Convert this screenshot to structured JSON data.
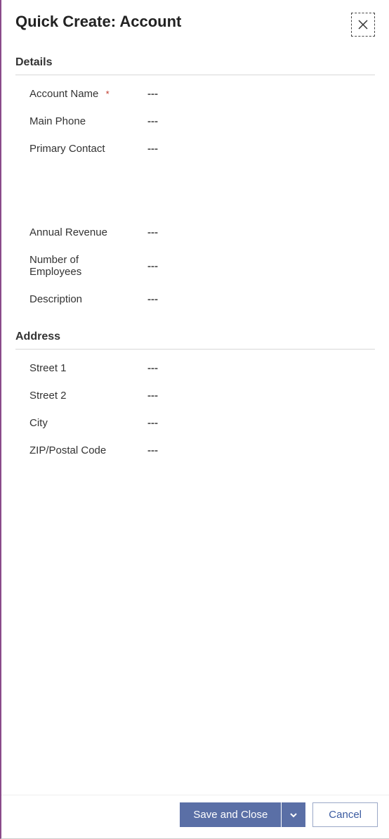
{
  "header": {
    "title": "Quick Create: Account"
  },
  "sections": {
    "details": {
      "title": "Details",
      "fields": {
        "account_name": {
          "label": "Account Name",
          "required_marker": "*",
          "value": "---"
        },
        "main_phone": {
          "label": "Main Phone",
          "value": "---"
        },
        "primary_contact": {
          "label": "Primary Contact",
          "value": "---"
        },
        "annual_revenue": {
          "label": "Annual Revenue",
          "value": "---"
        },
        "num_employees": {
          "label": "Number of Employees",
          "value": "---"
        },
        "description": {
          "label": "Description",
          "value": "---"
        }
      }
    },
    "address": {
      "title": "Address",
      "fields": {
        "street1": {
          "label": "Street 1",
          "value": "---"
        },
        "street2": {
          "label": "Street 2",
          "value": "---"
        },
        "city": {
          "label": "City",
          "value": "---"
        },
        "zip": {
          "label": "ZIP/Postal Code",
          "value": "---"
        }
      }
    }
  },
  "footer": {
    "save_label": "Save and Close",
    "cancel_label": "Cancel"
  }
}
